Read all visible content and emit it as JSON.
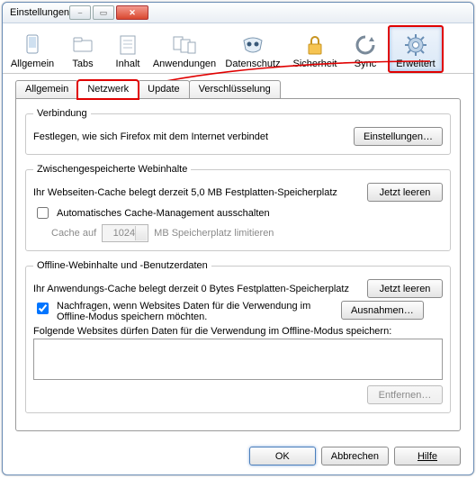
{
  "window": {
    "title": "Einstellungen"
  },
  "toolbar": {
    "items": [
      {
        "label": "Allgemein"
      },
      {
        "label": "Tabs"
      },
      {
        "label": "Inhalt"
      },
      {
        "label": "Anwendungen"
      },
      {
        "label": "Datenschutz"
      },
      {
        "label": "Sicherheit"
      },
      {
        "label": "Sync"
      },
      {
        "label": "Erweitert"
      }
    ]
  },
  "subtabs": {
    "items": [
      {
        "label": "Allgemein"
      },
      {
        "label": "Netzwerk"
      },
      {
        "label": "Update"
      },
      {
        "label": "Verschlüsselung"
      }
    ]
  },
  "connection": {
    "legend": "Verbindung",
    "desc": "Festlegen, wie sich Firefox mit dem Internet verbindet",
    "button": "Einstellungen…"
  },
  "cache": {
    "legend": "Zwischengespeicherte Webinhalte",
    "desc": "Ihr Webseiten-Cache belegt derzeit 5,0 MB Festplatten-Speicherplatz",
    "clear": "Jetzt leeren",
    "auto_off": "Automatisches Cache-Management ausschalten",
    "limit_pre": "Cache auf",
    "limit_val": "1024",
    "limit_post": "MB Speicherplatz limitieren"
  },
  "offline": {
    "legend": "Offline-Webinhalte und -Benutzerdaten",
    "desc": "Ihr Anwendungs-Cache belegt derzeit 0 Bytes Festplatten-Speicherplatz",
    "clear": "Jetzt leeren",
    "ask": "Nachfragen, wenn Websites Daten für die Verwendung im Offline-Modus speichern möchten.",
    "exceptions": "Ausnahmen…",
    "list_label": "Folgende Websites dürfen Daten für die Verwendung im Offline-Modus speichern:",
    "remove": "Entfernen…"
  },
  "footer": {
    "ok": "OK",
    "cancel": "Abbrechen",
    "help": "Hilfe"
  }
}
